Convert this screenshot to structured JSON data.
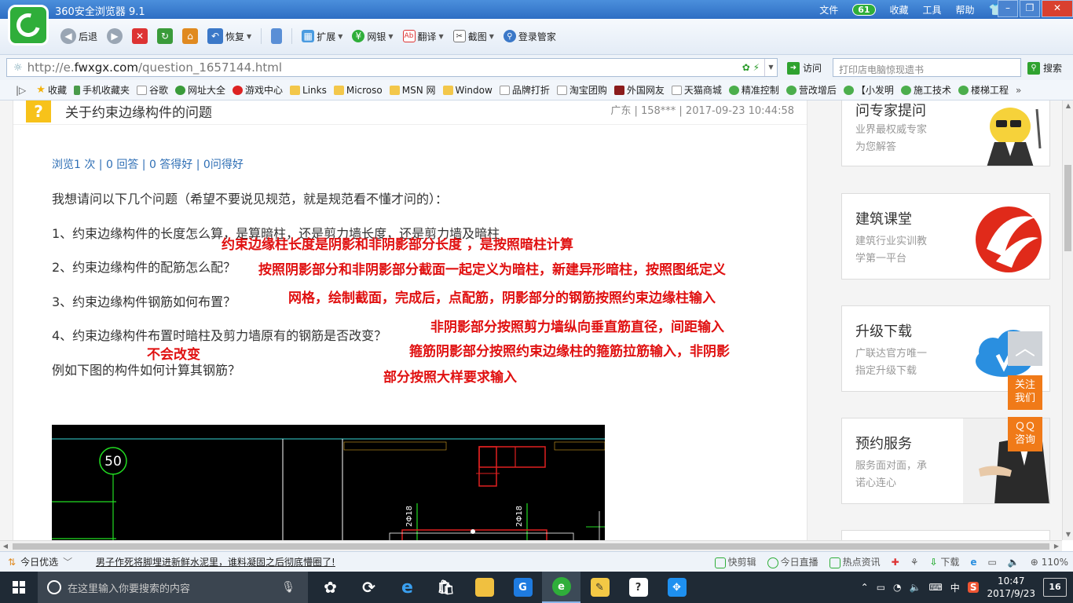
{
  "browser": {
    "title": "360安全浏览器 9.1",
    "menu": [
      "文件",
      "收藏",
      "工具",
      "帮助"
    ],
    "badge_count": "61",
    "toolbar": {
      "back": "后退",
      "restore": "恢复",
      "extend": "扩展",
      "bank": "网银",
      "translate": "翻译",
      "screenshot": "截图",
      "login": "登录管家"
    },
    "url_scheme": "http://e.",
    "url_host": "fwxgx.com",
    "url_path": "/question_1657144.html",
    "visit_label": "访问",
    "search_placeholder": "打印店电脑惊现遗书",
    "search_button": "搜索",
    "favorites": [
      {
        "label": "收藏",
        "icon": "star"
      },
      {
        "label": "手机收藏夹",
        "icon": "phone"
      },
      {
        "label": "谷歌",
        "icon": "page"
      },
      {
        "label": "网址大全",
        "icon": "green"
      },
      {
        "label": "游戏中心",
        "icon": "red"
      },
      {
        "label": "Links",
        "icon": "folder"
      },
      {
        "label": "Microso",
        "icon": "folder"
      },
      {
        "label": "MSN 网",
        "icon": "folder"
      },
      {
        "label": "Window",
        "icon": "folder"
      },
      {
        "label": "品牌打折",
        "icon": "page"
      },
      {
        "label": "淘宝团购",
        "icon": "page"
      },
      {
        "label": "外国网友",
        "icon": "dark"
      },
      {
        "label": "天猫商城",
        "icon": "page"
      },
      {
        "label": "精准控制",
        "icon": "wechat"
      },
      {
        "label": "营改增后",
        "icon": "wechat"
      },
      {
        "label": "【小发明",
        "icon": "wechat"
      },
      {
        "label": "施工技术",
        "icon": "wechat"
      },
      {
        "label": "楼梯工程",
        "icon": "wechat"
      }
    ]
  },
  "question": {
    "title": "关于约束边缘构件的问题",
    "meta": "广东 | 158*** | 2017-09-23 10:44:58",
    "stats": "浏览1 次 | 0 回答 | 0 答得好 | 0问得好",
    "paragraphs": [
      "我想请问以下几个问题（希望不要说见规范，就是规范看不懂才问的）：",
      "1、约束边缘构件的长度怎么算，是算暗柱，还是剪力墙长度，还是剪力墙及暗柱",
      "2、约束边缘构件的配筋怎么配？",
      "3、约束边缘构件钢筋如何布置？",
      "4、约束边缘构件布置时暗柱及剪力墙原有的钢筋是否改变？",
      "例如下图的构件如何计算其钢筋？"
    ],
    "cad_label_circle": "50",
    "cad_rebar_1": "2Φ18",
    "cad_rebar_2": "2Φ18"
  },
  "annotations": [
    "约束边缘柱长度是阴影和非阴影部分长度 ，是按照暗柱计算",
    "按照阴影部分和非阴影部分截面一起定义为暗柱，新建异形暗柱，按照图纸定义",
    "网格，绘制截面，完成后，点配筋，阴影部分的钢筋按照约束边缘柱输入",
    "非阴影部分按照剪力墙纵向垂直筋直径，间距输入",
    "箍筋阴影部分按照约束边缘柱的箍筋拉筋输入，非阴影",
    "部分按照大样要求输入",
    "不会改变"
  ],
  "sidebar": [
    {
      "title": "问专家提问",
      "desc": [
        "业界最权威专家",
        "为您解答"
      ]
    },
    {
      "title": "建筑课堂",
      "desc": [
        "建筑行业实训教",
        "学第一平台"
      ]
    },
    {
      "title": "升级下载",
      "desc": [
        "广联达官方唯一",
        "指定升级下载"
      ]
    },
    {
      "title": "预约服务",
      "desc": [
        "服务面对面，承",
        "诺心连心"
      ]
    }
  ],
  "float": {
    "follow": "关注我们",
    "qq": "ＱＱ咨询"
  },
  "statusbar": {
    "today": "今日优选",
    "news": "男子作死将脚埋进新鲜水泥里，谁料凝固之后彻底懵圈了!",
    "right": [
      "快剪辑",
      "今日直播",
      "热点资讯",
      "下载",
      "110%"
    ]
  },
  "taskbar": {
    "search_placeholder": "在这里输入你要搜索的内容",
    "ime": "中",
    "time": "10:47",
    "date": "2017/9/23",
    "notifications": "16"
  },
  "colors": {
    "annotation_red": "#e01010",
    "link_blue": "#2f6fb5",
    "float_orange": "#f07a18",
    "brand_green": "#2fae3a"
  }
}
